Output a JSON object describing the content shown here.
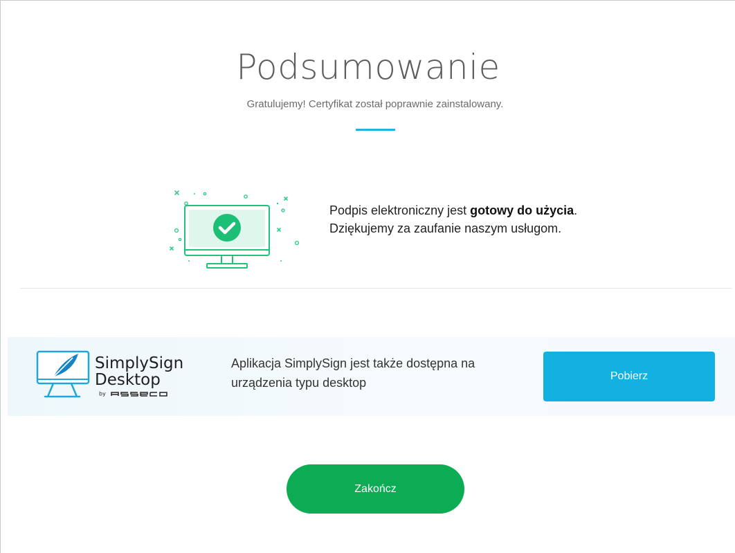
{
  "summary": {
    "title": "Podsumowanie",
    "subtitle": "Gratulujemy! Certyfikat został poprawnie zainstalowany."
  },
  "ready": {
    "line1_prefix": "Podpis elektroniczny jest ",
    "line1_bold": "gotowy do użycia",
    "line1_suffix": ".",
    "line2": "Dziękujemy za zaufanie naszym usługom."
  },
  "promo": {
    "logo_title": "SimplySign",
    "logo_subtitle": "Desktop",
    "logo_by": "by",
    "logo_brand": "asseco",
    "text": "Aplikacja SimplySign jest także dostępna na urządzenia typu desktop",
    "download_label": "Pobierz"
  },
  "actions": {
    "finish_label": "Zakończ"
  },
  "colors": {
    "accent": "#1fb3e0",
    "success": "#0cac55",
    "download": "#13b0e2",
    "illustration_green": "#20c27a"
  },
  "icons": {
    "illustration": "monitor-check-icon",
    "logo": "monitor-feather-icon"
  }
}
